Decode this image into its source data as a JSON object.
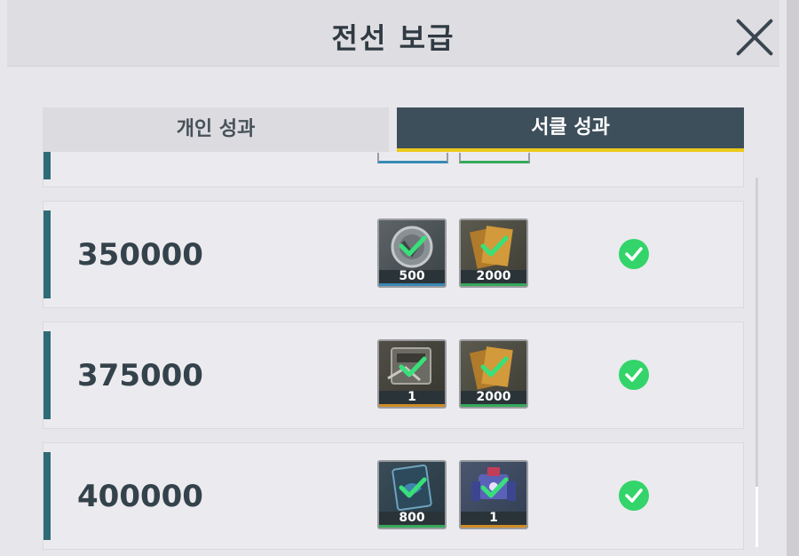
{
  "header": {
    "title": "전선 보급"
  },
  "tabs": [
    {
      "label": "개인 성과",
      "active": false
    },
    {
      "label": "서클 성과",
      "active": true
    }
  ],
  "rows": [
    {
      "score": "350000",
      "claimed": true,
      "rewards": [
        {
          "icon": "silver-coin-icon",
          "qty": "500",
          "rarity": "blue"
        },
        {
          "icon": "gold-bar-icon",
          "qty": "2000",
          "rarity": "green"
        }
      ]
    },
    {
      "score": "375000",
      "claimed": true,
      "rewards": [
        {
          "icon": "data-chip-icon",
          "qty": "1",
          "rarity": "orange"
        },
        {
          "icon": "gold-bar-icon",
          "qty": "2000",
          "rarity": "green"
        }
      ]
    },
    {
      "score": "400000",
      "claimed": true,
      "rewards": [
        {
          "icon": "tech-card-icon",
          "qty": "800",
          "rarity": "green"
        },
        {
          "icon": "mech-unit-icon",
          "qty": "1",
          "rarity": "orange"
        }
      ]
    }
  ],
  "colors": {
    "accent_dark": "#3d4f5a",
    "tab_underline": "#ecc81a",
    "check_green": "#33d46a"
  }
}
